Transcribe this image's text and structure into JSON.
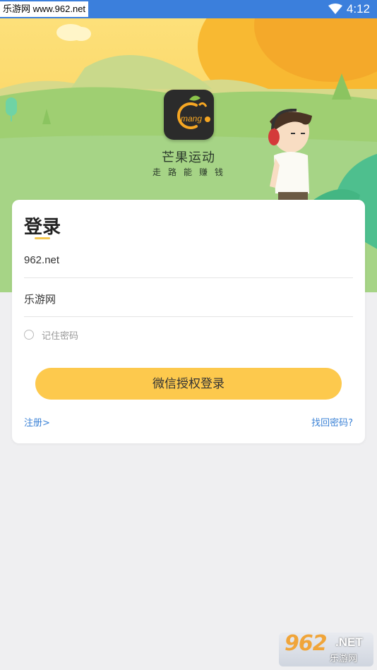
{
  "status_bar": {
    "watermark_text": "乐游网 www.962.net",
    "time": "4:12",
    "wifi_icon": "wifi-icon"
  },
  "app": {
    "logo_icon": "mango-logo-icon",
    "logo_text": "mang",
    "name": "芒果运动",
    "slogan": "走路能赚钱"
  },
  "login": {
    "title": "登录",
    "username_value": "962.net",
    "password_value": "乐游网",
    "remember_label": "记住密码",
    "wechat_button": "微信授权登录",
    "register_link": "注册>",
    "forgot_link": "找回密码?"
  },
  "watermark_logo": {
    "number": "962",
    "net": ".NET",
    "cn": "乐游网"
  },
  "colors": {
    "status_bar": "#3b7fdc",
    "accent_yellow": "#fdc94d",
    "link_blue": "#3b82d6",
    "hero_green": "#9ed07a",
    "hero_sky": "#fbe37a"
  }
}
